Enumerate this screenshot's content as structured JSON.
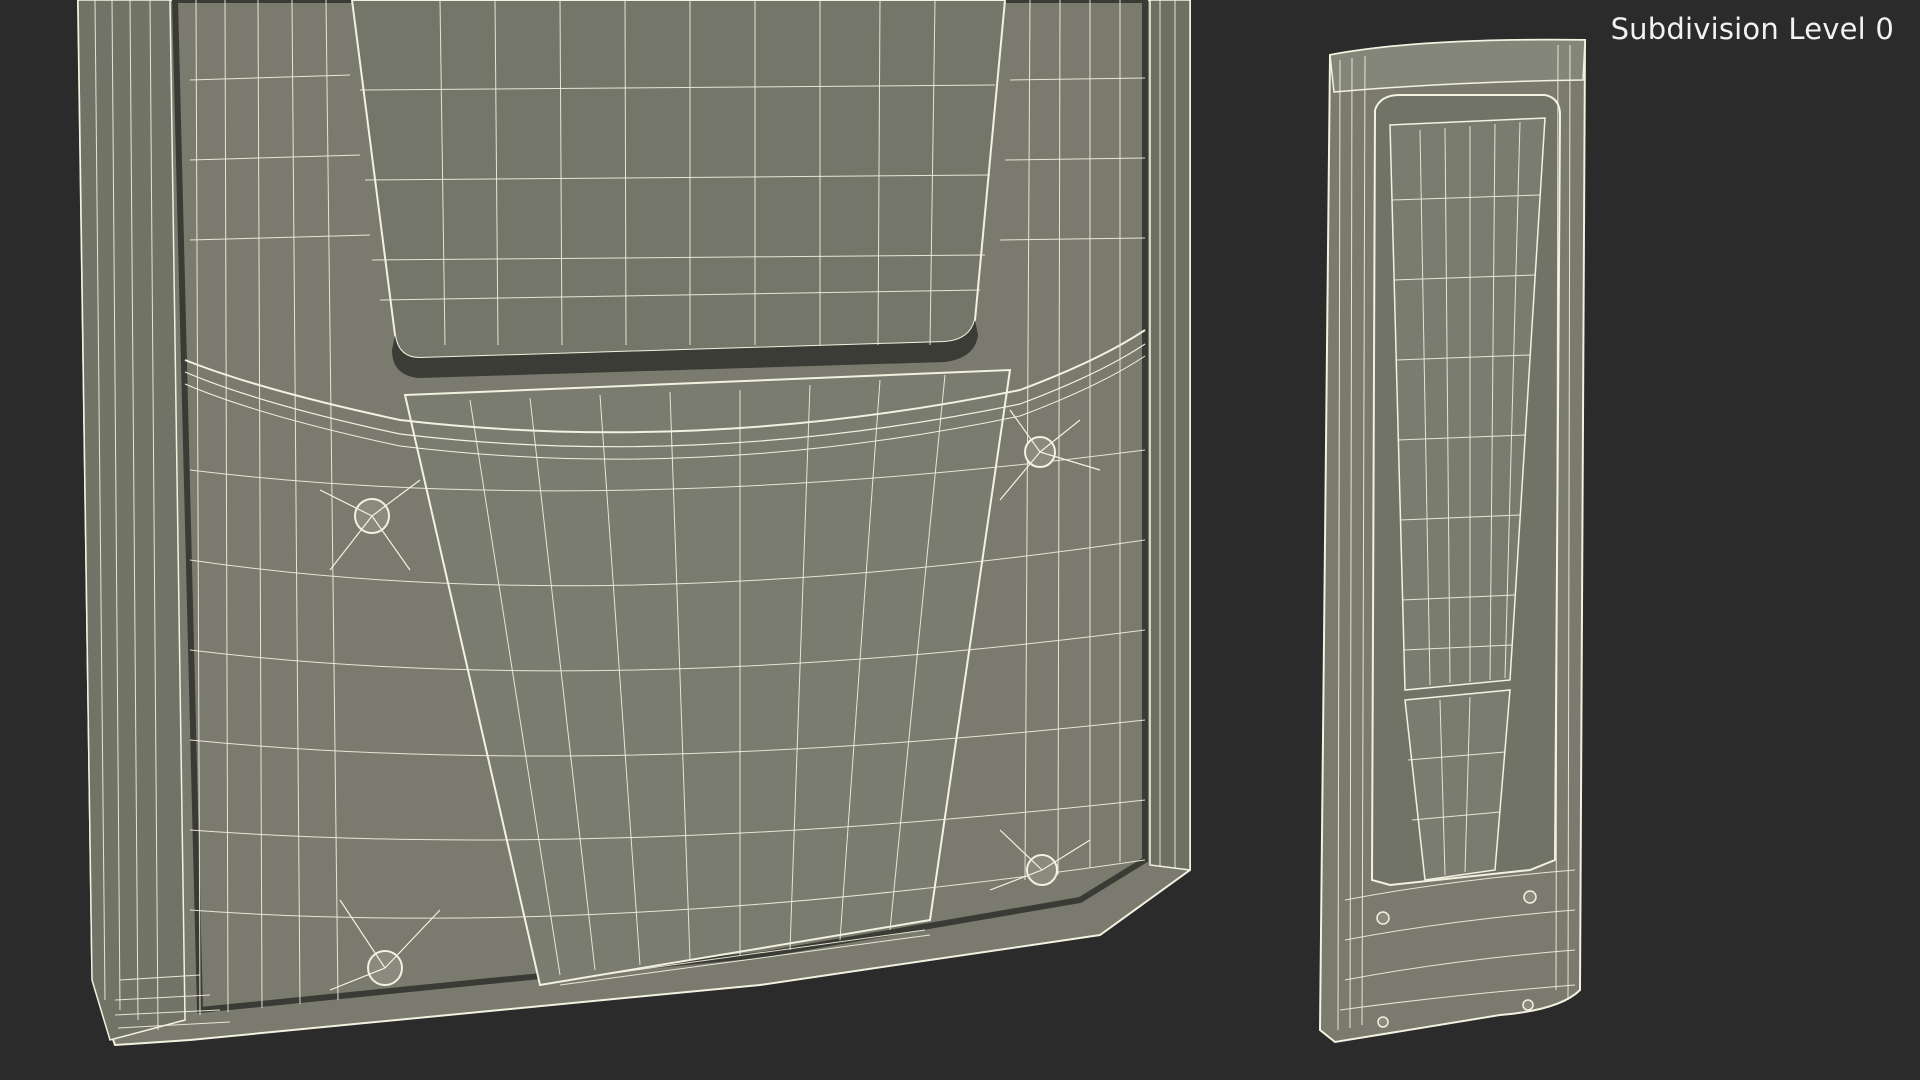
{
  "viewport": {
    "subdivision_label": "Subdivision Level 0"
  },
  "scene": {
    "background_color": "#2b2b2b",
    "surface_color": "#7a7b6e",
    "surface_shadow_color": "#64655a",
    "wire_color": "#f3f1e0",
    "objects": [
      "large-panel-closeup",
      "full-panel-side-view"
    ]
  }
}
